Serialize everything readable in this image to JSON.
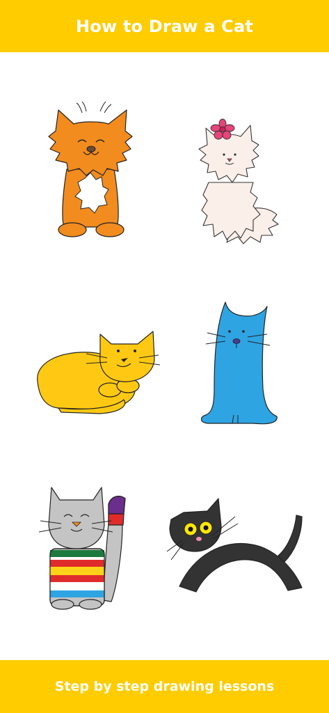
{
  "header": {
    "title": "How to Draw a Cat"
  },
  "footer": {
    "tagline": "Step by step drawing lessons"
  },
  "colors": {
    "accent": "#FFCC00",
    "ginger": "#F28C1E",
    "cream": "#FBEFE9",
    "yellow": "#FFC913",
    "blue": "#2FA4E3",
    "grey": "#C4C4C4",
    "black": "#333333"
  },
  "cats": [
    {
      "icon": "ginger-fluffy-cat-icon"
    },
    {
      "icon": "white-fluffy-cat-with-pink-flower-icon"
    },
    {
      "icon": "yellow-sleeping-cat-icon"
    },
    {
      "icon": "tall-blue-cat-icon"
    },
    {
      "icon": "grey-cat-in-striped-sweater-icon"
    },
    {
      "icon": "black-arched-cat-icon"
    }
  ]
}
